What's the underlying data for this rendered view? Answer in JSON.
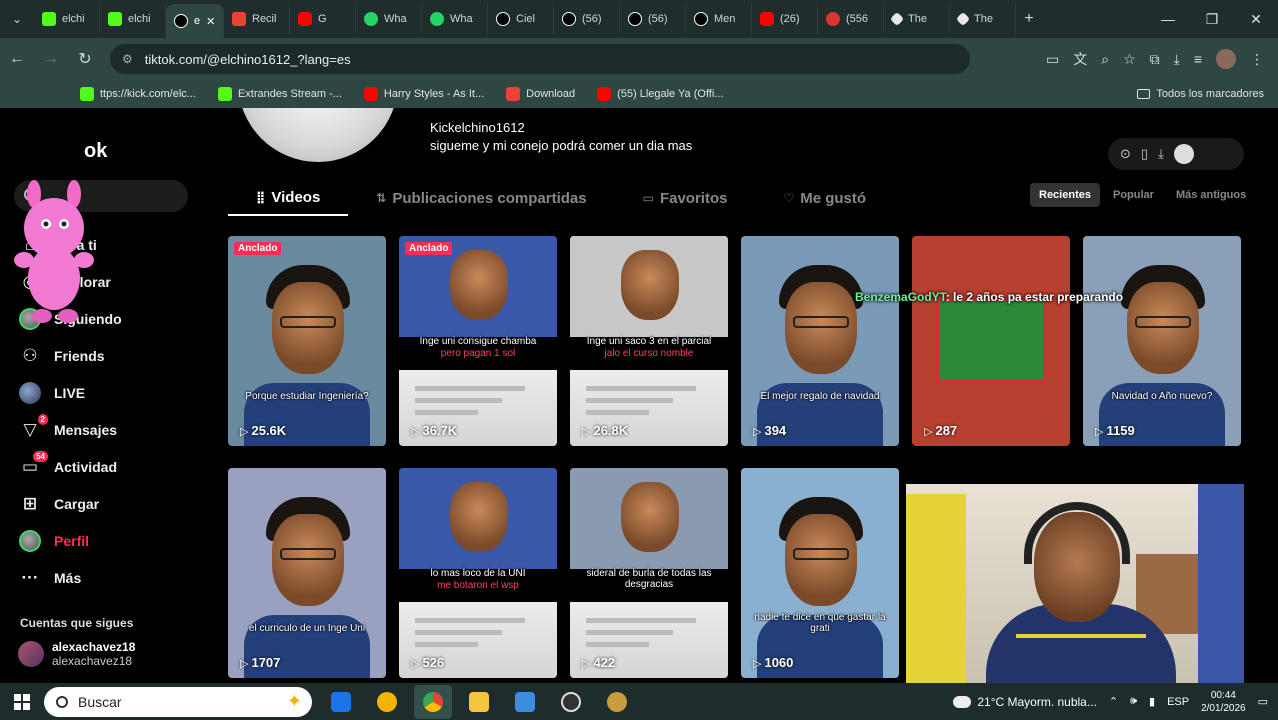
{
  "browser": {
    "tabs": [
      {
        "label": "elchi",
        "fav": "kick"
      },
      {
        "label": "elchi",
        "fav": "kick"
      },
      {
        "label": "e",
        "fav": "tt",
        "active": true
      },
      {
        "label": "Recil",
        "fav": "gm"
      },
      {
        "label": "G",
        "fav": "yt"
      },
      {
        "label": "Wha",
        "fav": "wa"
      },
      {
        "label": "Wha",
        "fav": "wa"
      },
      {
        "label": "Ciel",
        "fav": "tt"
      },
      {
        "label": "(56)",
        "fav": "tt"
      },
      {
        "label": "(56)",
        "fav": "tt"
      },
      {
        "label": "Men",
        "fav": "tt"
      },
      {
        "label": "(26)",
        "fav": "yt"
      },
      {
        "label": "(556",
        "fav": "red2"
      },
      {
        "label": "The",
        "fav": "gen"
      },
      {
        "label": "The",
        "fav": "gen"
      }
    ],
    "url": "tiktok.com/@elchino1612_?lang=es",
    "bookmarks": [
      {
        "label": "ttps://kick.com/elc...",
        "fav": "kick"
      },
      {
        "label": "Extrandes Stream -...",
        "fav": "kick"
      },
      {
        "label": "Harry Styles - As It...",
        "fav": "yt"
      },
      {
        "label": "Download",
        "fav": "gm"
      },
      {
        "label": "(55) Llegale Ya (Offi...",
        "fav": "yt"
      }
    ],
    "bookmarks_all": "Todos los marcadores"
  },
  "sidebar": {
    "logo": "ok",
    "items": [
      {
        "label": "Para ti",
        "icon": "home-icon",
        "glyph": "⌂"
      },
      {
        "label": "Explorar",
        "icon": "compass-icon",
        "glyph": "◎"
      },
      {
        "label": "Siguiendo",
        "icon": "following-avatar-icon",
        "glyph": ""
      },
      {
        "label": "Friends",
        "icon": "friends-icon",
        "glyph": "⚇"
      },
      {
        "label": "LIVE",
        "icon": "live-icon",
        "glyph": ""
      },
      {
        "label": "Mensajes",
        "icon": "messages-icon",
        "glyph": "▽",
        "badge": "2"
      },
      {
        "label": "Actividad",
        "icon": "activity-icon",
        "glyph": "▭",
        "badge": "54"
      },
      {
        "label": "Cargar",
        "icon": "upload-icon",
        "glyph": "⊞"
      },
      {
        "label": "Perfil",
        "icon": "profile-avatar-icon",
        "glyph": "",
        "active": true
      },
      {
        "label": "Más",
        "icon": "more-icon",
        "glyph": "···"
      }
    ],
    "following_title": "Cuentas que sigues",
    "following": [
      {
        "name": "alexachavez18",
        "user": "alexachavez18"
      }
    ]
  },
  "profile": {
    "handle": "Kickelchino1612",
    "bio": "sigueme y mi conejo podrá comer un dia mas",
    "tabs": [
      {
        "label": "Videos",
        "active": true,
        "glyph": "⣿"
      },
      {
        "label": "Publicaciones compartidas",
        "glyph": "⇅"
      },
      {
        "label": "Favoritos",
        "glyph": "▭"
      },
      {
        "label": "Me gustó",
        "glyph": "♡"
      }
    ],
    "sort": [
      {
        "label": "Recientes",
        "active": true
      },
      {
        "label": "Popular"
      },
      {
        "label": "Más antiguos"
      }
    ]
  },
  "videos": [
    {
      "views": "25.6K",
      "pinned": "Anclado",
      "captions": [
        {
          "text": "Porque estudiar Ingeniería?",
          "red": false
        }
      ],
      "bg": "#6a8aa0",
      "style": "face"
    },
    {
      "views": "36.7K",
      "pinned": "Anclado",
      "captions": [
        {
          "text": "Inge uni consigue chamba",
          "red": false
        },
        {
          "text": "pero pagan 1 sol",
          "red": true
        }
      ],
      "bg": "#3a58a8",
      "style": "split"
    },
    {
      "views": "26.8K",
      "captions": [
        {
          "text": "Inge uni saco 3 en el parcial",
          "red": false
        },
        {
          "text": "jalo el curso nomble",
          "red": true
        }
      ],
      "bg": "#c8c8c8",
      "style": "split"
    },
    {
      "views": "394",
      "captions": [
        {
          "text": "El mejor regalo de navidad",
          "red": false
        }
      ],
      "bg": "#7a9ab8",
      "style": "face"
    },
    {
      "views": "287",
      "captions": [],
      "bg": "#b84030",
      "style": "plain"
    },
    {
      "views": "1159",
      "captions": [
        {
          "text": "Navidad o Año nuevo?",
          "red": false
        }
      ],
      "bg": "#8aa0b8",
      "style": "face"
    },
    {
      "views": "1707",
      "captions": [
        {
          "text": "el curriculo de un Inge Uni",
          "red": false
        }
      ],
      "bg": "#9aa0c0",
      "style": "face"
    },
    {
      "views": "526",
      "captions": [
        {
          "text": "lo mas loco de la UNI",
          "red": false
        },
        {
          "text": "me botaron el wsp",
          "red": true
        }
      ],
      "bg": "#3a58a8",
      "style": "split"
    },
    {
      "views": "422",
      "captions": [
        {
          "text": "sideral de burla de todas las desgracias",
          "red": false
        }
      ],
      "bg": "#8a9ab0",
      "style": "split"
    },
    {
      "views": "1060",
      "captions": [
        {
          "text": "nadie te dice en que gastar la grati",
          "red": false
        }
      ],
      "bg": "#8ab0d0",
      "style": "face"
    }
  ],
  "overlay": {
    "chat_user": "BenzemaGodYT",
    "chat_msg": ": le 2 años pa estar preparando"
  },
  "taskbar": {
    "search_placeholder": "Buscar",
    "weather": "21°C  Mayorm. nubla...",
    "lang": "ESP",
    "time": "00:44",
    "date": "2/01/2026"
  },
  "colors": {
    "accent": "#fe2c55",
    "chrome": "#2f4743",
    "tabstrip": "#1f2e2c"
  }
}
